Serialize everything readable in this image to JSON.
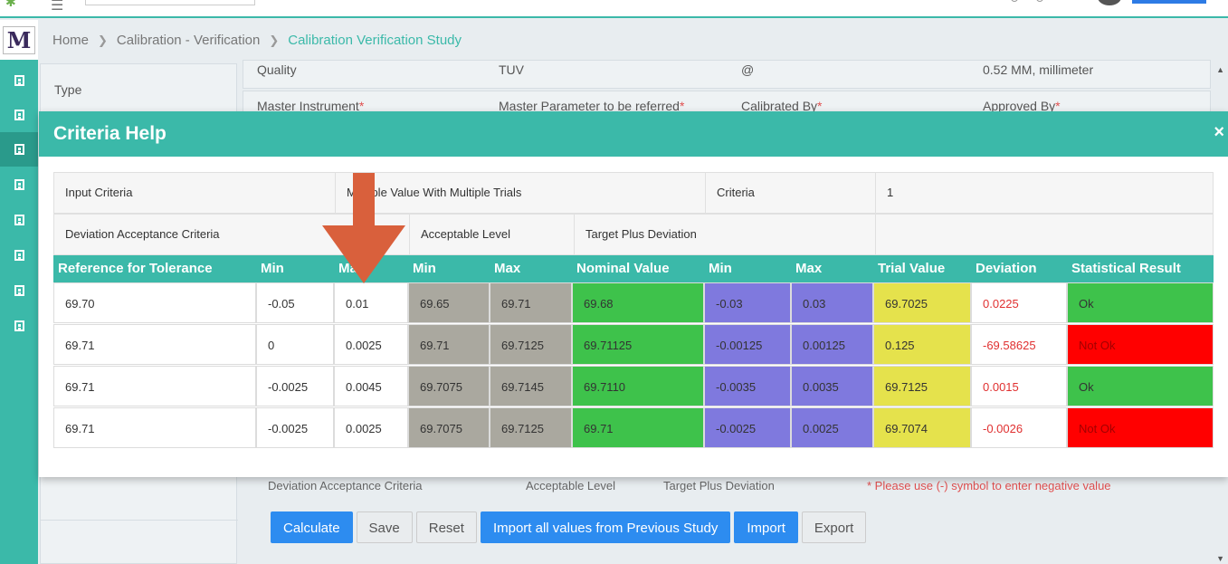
{
  "breadcrumb": {
    "home": "Home",
    "section": "Calibration - Verification",
    "current": "Calibration Verification Study"
  },
  "left_panel": {
    "type_label": "Type"
  },
  "background_rows": {
    "row1": [
      "Quality",
      "TUV",
      "@",
      "0.52 MM, millimeter"
    ],
    "row2": [
      {
        "label": "Master Instrument",
        "req": "*"
      },
      {
        "label": "Master Parameter to be referred",
        "req": "*"
      },
      {
        "label": "Calibrated By",
        "req": "*"
      },
      {
        "label": "Approved By",
        "req": "*"
      }
    ],
    "under_modal": [
      "Deviation Acceptance Criteria",
      "Acceptable Level",
      "Target Plus Deviation"
    ],
    "warning": "* Please use (-) symbol to enter negative value"
  },
  "buttons": {
    "calculate": "Calculate",
    "save": "Save",
    "reset": "Reset",
    "import_prev": "Import all values from Previous Study",
    "import": "Import",
    "export": "Export"
  },
  "modal": {
    "title": "Criteria Help",
    "close": "×",
    "info": {
      "input_criteria_label": "Input Criteria",
      "input_criteria_value": "Multiple Value With Multiple Trials",
      "criteria_label": "Criteria",
      "criteria_value": "1",
      "deviation_label": "Deviation Acceptance Criteria",
      "acceptable_label": "Acceptable Level",
      "target_label": "Target Plus Deviation"
    },
    "columns": [
      "Reference for Tolerance",
      "Min",
      "Max",
      "Min",
      "Max",
      "Nominal Value",
      "Min",
      "Max",
      "Trial Value",
      "Deviation",
      "Statistical Result"
    ],
    "rows": [
      [
        "69.70",
        "-0.05",
        "0.01",
        "69.65",
        "69.71",
        "69.68",
        "-0.03",
        "0.03",
        "69.7025",
        "0.0225",
        "Ok"
      ],
      [
        "69.71",
        "0",
        "0.0025",
        "69.71",
        "69.7125",
        "69.71125",
        "-0.00125",
        "0.00125",
        "0.125",
        "-69.58625",
        "Not Ok"
      ],
      [
        "69.71",
        "-0.0025",
        "0.0045",
        "69.7075",
        "69.7145",
        "69.7110",
        "-0.0035",
        "0.0035",
        "69.7125",
        "0.0015",
        "Ok"
      ],
      [
        "69.71",
        "-0.0025",
        "0.0025",
        "69.7075",
        "69.7125",
        "69.71",
        "-0.0025",
        "0.0025",
        "69.7074",
        "-0.0026",
        "Not Ok"
      ]
    ]
  },
  "colors": {
    "teal": "#3bb9a9",
    "gray_level": "#aaa89f",
    "green_nominal": "#3ec24b",
    "purple_deviation": "#7f79de",
    "yellow_trial": "#e5e24c",
    "red_not_ok": "#ff0000",
    "green_ok": "#3ec24b",
    "arrow": "#d9603c"
  }
}
